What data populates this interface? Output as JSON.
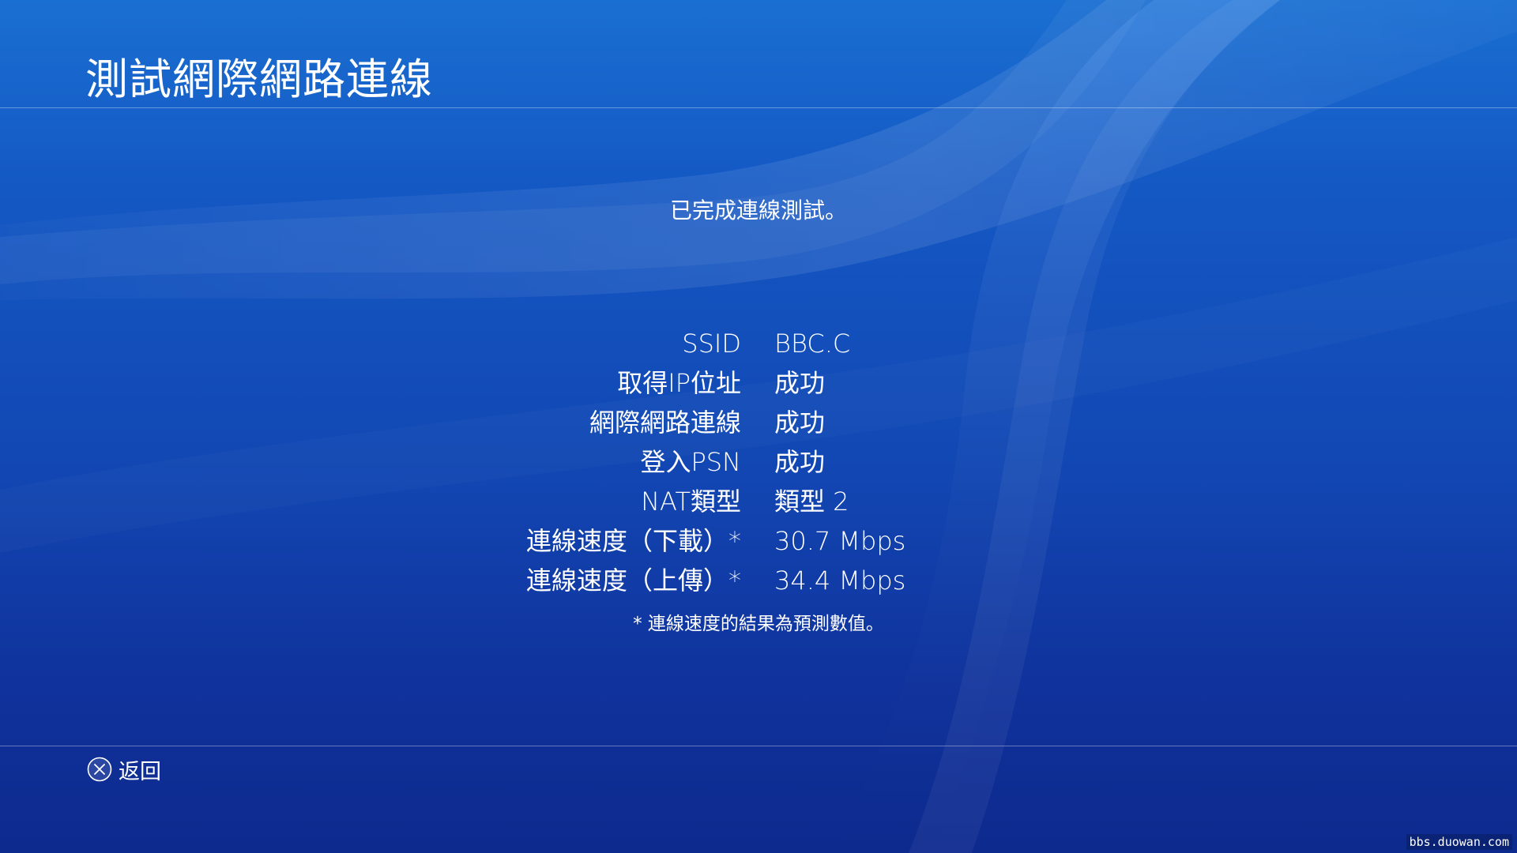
{
  "header": {
    "title": "測試網際網路連線"
  },
  "status_message": "已完成連線測試。",
  "results": [
    {
      "label": "SSID",
      "value": "BBC.C"
    },
    {
      "label": "取得IP位址",
      "value": "成功"
    },
    {
      "label": "網際網路連線",
      "value": "成功"
    },
    {
      "label": "登入PSN",
      "value": "成功"
    },
    {
      "label": "NAT類型",
      "value": "類型 2"
    },
    {
      "label": "連線速度（下載）*",
      "value": "30.7 Mbps"
    },
    {
      "label": "連線速度（上傳）*",
      "value": "34.4 Mbps"
    }
  ],
  "footnote": "* 連線速度的結果為預測數值。",
  "footer": {
    "back_button_icon": "cross-button-icon",
    "back_label": "返回"
  },
  "watermark": "bbs.duowan.com",
  "colors": {
    "background_top": "#1a6fd2",
    "background_bottom": "#0d2a8e",
    "text": "#ffffff"
  }
}
